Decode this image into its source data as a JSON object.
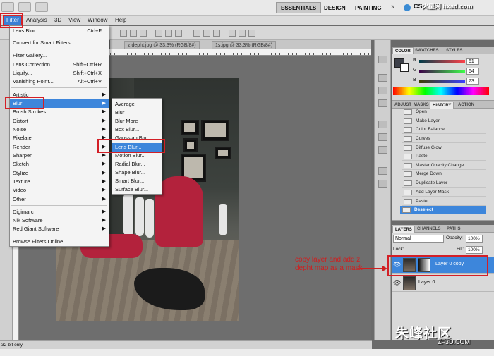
{
  "app_bar": {
    "workspaces": [
      "ESSENTIALS",
      "DESIGN",
      "PAINTING"
    ],
    "active_workspace": "ESSENTIALS",
    "more": "»",
    "account_prefix": "CS"
  },
  "menubar": {
    "items": [
      "Filter",
      "Analysis",
      "3D",
      "View",
      "Window",
      "Help"
    ],
    "selected": "Filter"
  },
  "document_tabs": [
    "z depht.jpg @ 33.3% (RGB/8#)",
    "1s.jpg @ 33.3% (RGB/8#)"
  ],
  "filter_menu": {
    "items": [
      {
        "label": "Lens Blur",
        "shortcut": "Ctrl+F"
      },
      {
        "label": "Convert for Smart Filters"
      },
      {
        "label": "Filter Gallery..."
      },
      {
        "label": "Lens Correction...",
        "shortcut": "Shift+Ctrl+R"
      },
      {
        "label": "Liquify...",
        "shortcut": "Shift+Ctrl+X"
      },
      {
        "label": "Vanishing Point...",
        "shortcut": "Alt+Ctrl+V"
      },
      {
        "label": "Artistic",
        "submenu": true
      },
      {
        "label": "Blur",
        "submenu": true,
        "highlighted": true
      },
      {
        "label": "Brush Strokes",
        "submenu": true
      },
      {
        "label": "Distort",
        "submenu": true
      },
      {
        "label": "Noise",
        "submenu": true
      },
      {
        "label": "Pixelate",
        "submenu": true
      },
      {
        "label": "Render",
        "submenu": true
      },
      {
        "label": "Sharpen",
        "submenu": true
      },
      {
        "label": "Sketch",
        "submenu": true
      },
      {
        "label": "Stylize",
        "submenu": true
      },
      {
        "label": "Texture",
        "submenu": true
      },
      {
        "label": "Video",
        "submenu": true
      },
      {
        "label": "Other",
        "submenu": true
      },
      {
        "label": "Digimarc",
        "submenu": true
      },
      {
        "label": "Nik Software",
        "submenu": true
      },
      {
        "label": "Red Giant Software",
        "submenu": true
      },
      {
        "label": "Browse Filters Online..."
      }
    ]
  },
  "blur_submenu": {
    "items": [
      "Average",
      "Blur",
      "Blur More",
      "Box Blur...",
      "Gaussian Blur...",
      "Lens Blur...",
      "Motion Blur...",
      "Radial Blur...",
      "Shape Blur...",
      "Smart Blur...",
      "Surface Blur..."
    ],
    "highlighted": "Lens Blur..."
  },
  "color_panel": {
    "tabs": [
      "COLOR",
      "SWATCHES",
      "STYLES"
    ],
    "active_tab": "COLOR",
    "r": "61",
    "g": "64",
    "b": "73",
    "r_label": "R",
    "g_label": "G",
    "b_label": "B",
    "fg_color": "#3d4049"
  },
  "history_panel": {
    "tabs": [
      "ADJUST",
      "MASKS",
      "HISTORY",
      "ACTION"
    ],
    "active_tab": "HISTORY",
    "steps": [
      "Open",
      "Make Layer",
      "Color Balance",
      "Curves",
      "Diffuse Glow",
      "Paste",
      "Master Opacity Change",
      "Merge Down",
      "Duplicate Layer",
      "Add Layer Mask",
      "Paste",
      "Deselect"
    ],
    "selected": "Deselect"
  },
  "layers_panel": {
    "tabs": [
      "LAYERS",
      "CHANNELS",
      "PATHS"
    ],
    "active_tab": "LAYERS",
    "blend_mode": "Normal",
    "opacity_label": "Opacity:",
    "opacity": "100%",
    "lock_label": "Lock:",
    "fill_label": "Fill:",
    "fill": "100%",
    "layers": [
      {
        "name": "Layer 0 copy",
        "selected": true
      },
      {
        "name": "Layer 0",
        "selected": false
      }
    ]
  },
  "annotation": {
    "text": "copy layer and add z depht map as a mask",
    "color": "#cf1f1f"
  },
  "status": "32-bit only",
  "watermark": {
    "cn": "朱峰社区",
    "url": "ZF3D.COM",
    "logo": "火星网 hxsd.com"
  },
  "colors": {
    "highlight": "#3d86db",
    "red_box": "#d31f26"
  }
}
